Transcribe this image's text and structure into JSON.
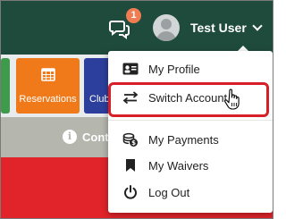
{
  "header": {
    "notifications_count": "1",
    "user_name": "Test User",
    "icons": {
      "chat": "chat-bubbles-icon",
      "avatar": "user-avatar",
      "dropdown": "chevron-down-icon"
    }
  },
  "tiles": {
    "reservations_label": "Reservations",
    "clubs_label": "Club",
    "icons": {
      "reservations": "calendar-icon"
    }
  },
  "info_band": {
    "text": "Conta",
    "icon": "info-icon"
  },
  "dropdown": {
    "items": [
      {
        "label": "My Profile",
        "icon": "id-card-icon"
      },
      {
        "label": "Switch Account",
        "icon": "switch-arrows-icon"
      },
      {
        "label": "My Payments",
        "icon": "coins-icon"
      },
      {
        "label": "My Waivers",
        "icon": "bookmark-icon"
      },
      {
        "label": "Log Out",
        "icon": "power-icon"
      }
    ],
    "highlighted": "Switch Account"
  },
  "colors": {
    "topbar": "#1f4b3d",
    "badge": "#f07c52",
    "reservations_tile": "#f07a1a",
    "clubs_tile": "#2c3f9c",
    "green_tile": "#3e9b4b",
    "info_band": "#b5b6ad",
    "red_band": "#e0242a",
    "highlight_border": "#d61f26"
  }
}
